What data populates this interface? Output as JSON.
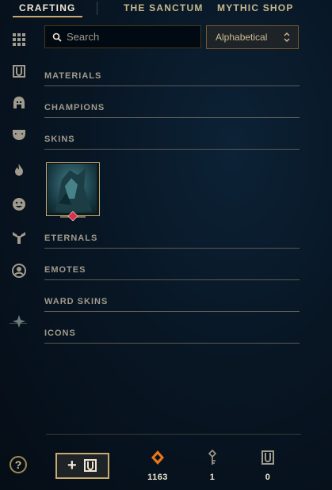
{
  "tabs": [
    {
      "label": "CRAFTING",
      "active": true
    },
    {
      "label": "THE SANCTUM",
      "active": false
    },
    {
      "label": "MYTHIC SHOP",
      "active": false
    }
  ],
  "sidebar": {
    "icons": [
      "grid-icon",
      "chest-icon",
      "champion-helmet-icon",
      "skin-mask-icon",
      "ward-flame-icon",
      "emote-face-icon",
      "eternals-icon",
      "summoner-icon-icon",
      "crafting-anvil-icon"
    ]
  },
  "search": {
    "placeholder": "Search",
    "value": ""
  },
  "sort": {
    "selected": "Alphabetical"
  },
  "sections": {
    "materials": "MATERIALS",
    "champions": "CHAMPIONS",
    "skins": "SKINS",
    "eternals": "ETERNALS",
    "emotes": "EMOTES",
    "ward_skins": "WARD SKINS",
    "icons": "ICONS"
  },
  "footer": {
    "add_button_plus": "+",
    "currencies": [
      {
        "name": "orange-essence",
        "icon": "orange-essence-icon",
        "value": "1163",
        "color": "#e8751a"
      },
      {
        "name": "keys",
        "icon": "key-icon",
        "value": "1"
      },
      {
        "name": "chests",
        "icon": "chest-icon",
        "value": "0"
      }
    ],
    "help": "?"
  },
  "colors": {
    "gold": "#c8aa6e",
    "background": "#081624",
    "text": "#a09b8c"
  }
}
